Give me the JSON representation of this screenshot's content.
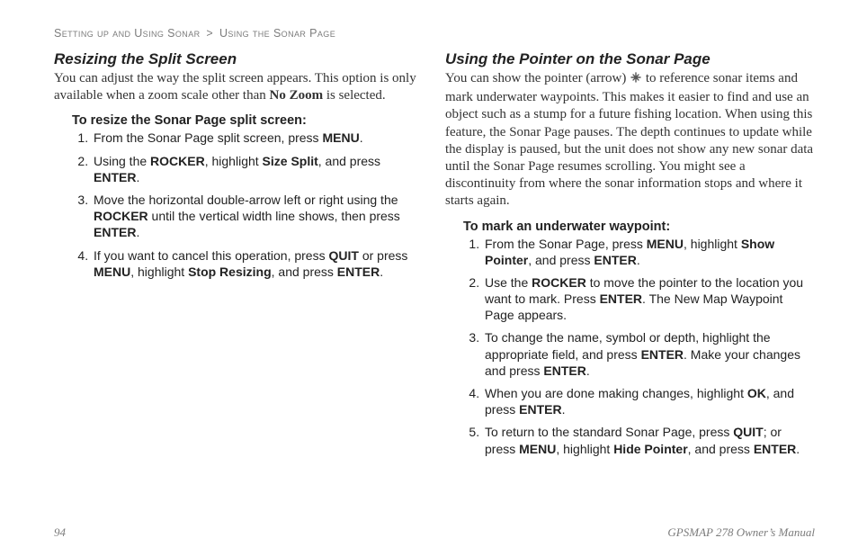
{
  "breadcrumb": {
    "section": "Setting up and Using Sonar",
    "page": "Using the Sonar Page"
  },
  "left": {
    "heading": "Resizing the Split Screen",
    "intro_parts": {
      "a": "You can adjust the way the split screen appears. This option is only available when a zoom scale other than ",
      "b": "No Zoom",
      "c": " is selected."
    },
    "procedure_title": "To resize the Sonar Page split screen:",
    "steps": {
      "s1": {
        "a": "From the Sonar Page split screen, press ",
        "b": "MENU",
        "c": "."
      },
      "s2": {
        "a": "Using the ",
        "b": "ROCKER",
        "c": ", highlight ",
        "d": "Size Split",
        "e": ", and press ",
        "f": "ENTER",
        "g": "."
      },
      "s3": {
        "a": "Move the horizontal double-arrow left or right using the ",
        "b": "ROCKER",
        "c": " until the vertical width line shows, then press ",
        "d": "ENTER",
        "e": "."
      },
      "s4": {
        "a": "If you want to cancel this operation, press ",
        "b": "QUIT",
        "c": " or press ",
        "d": "MENU",
        "e": ", highlight ",
        "f": "Stop Resizing",
        "g": ", and press ",
        "h": "ENTER",
        "i": "."
      }
    }
  },
  "right": {
    "heading": "Using the Pointer on the Sonar Page",
    "intro_parts": {
      "a": "You can show the pointer (arrow) ",
      "b": " to reference sonar items and mark underwater waypoints. This makes it easier to find and use an object such as a stump for a future fishing location. When using this feature, the Sonar Page pauses. The depth continues to update while the display is paused, but the unit does not show any new sonar data until the Sonar Page resumes scrolling. You might see a discontinuity from where the sonar information stops and where it starts again."
    },
    "procedure_title": "To mark an underwater waypoint:",
    "steps": {
      "s1": {
        "a": "From the Sonar Page, press ",
        "b": "MENU",
        "c": ", highlight ",
        "d": "Show Pointer",
        "e": ", and press ",
        "f": "ENTER",
        "g": "."
      },
      "s2": {
        "a": "Use the ",
        "b": "ROCKER",
        "c": " to move the pointer to the location you want to mark. Press ",
        "d": "ENTER",
        "e": ". The New Map Waypoint Page appears."
      },
      "s3": {
        "a": "To change the name, symbol or depth, highlight the appropriate field, and press ",
        "b": "ENTER",
        "c": ". Make your changes and press ",
        "d": "ENTER",
        "e": "."
      },
      "s4": {
        "a": "When you are done making changes, highlight ",
        "b": "OK",
        "c": ", and press ",
        "d": "ENTER",
        "e": "."
      },
      "s5": {
        "a": "To return to the standard Sonar Page, press ",
        "b": "QUIT",
        "c": "; or press ",
        "d": "MENU",
        "e": ", highlight ",
        "f": "Hide Pointer",
        "g": ", and press ",
        "h": "ENTER",
        "i": "."
      }
    }
  },
  "footer": {
    "page_number": "94",
    "manual_title": "GPSMAP 278 Owner’s Manual"
  }
}
